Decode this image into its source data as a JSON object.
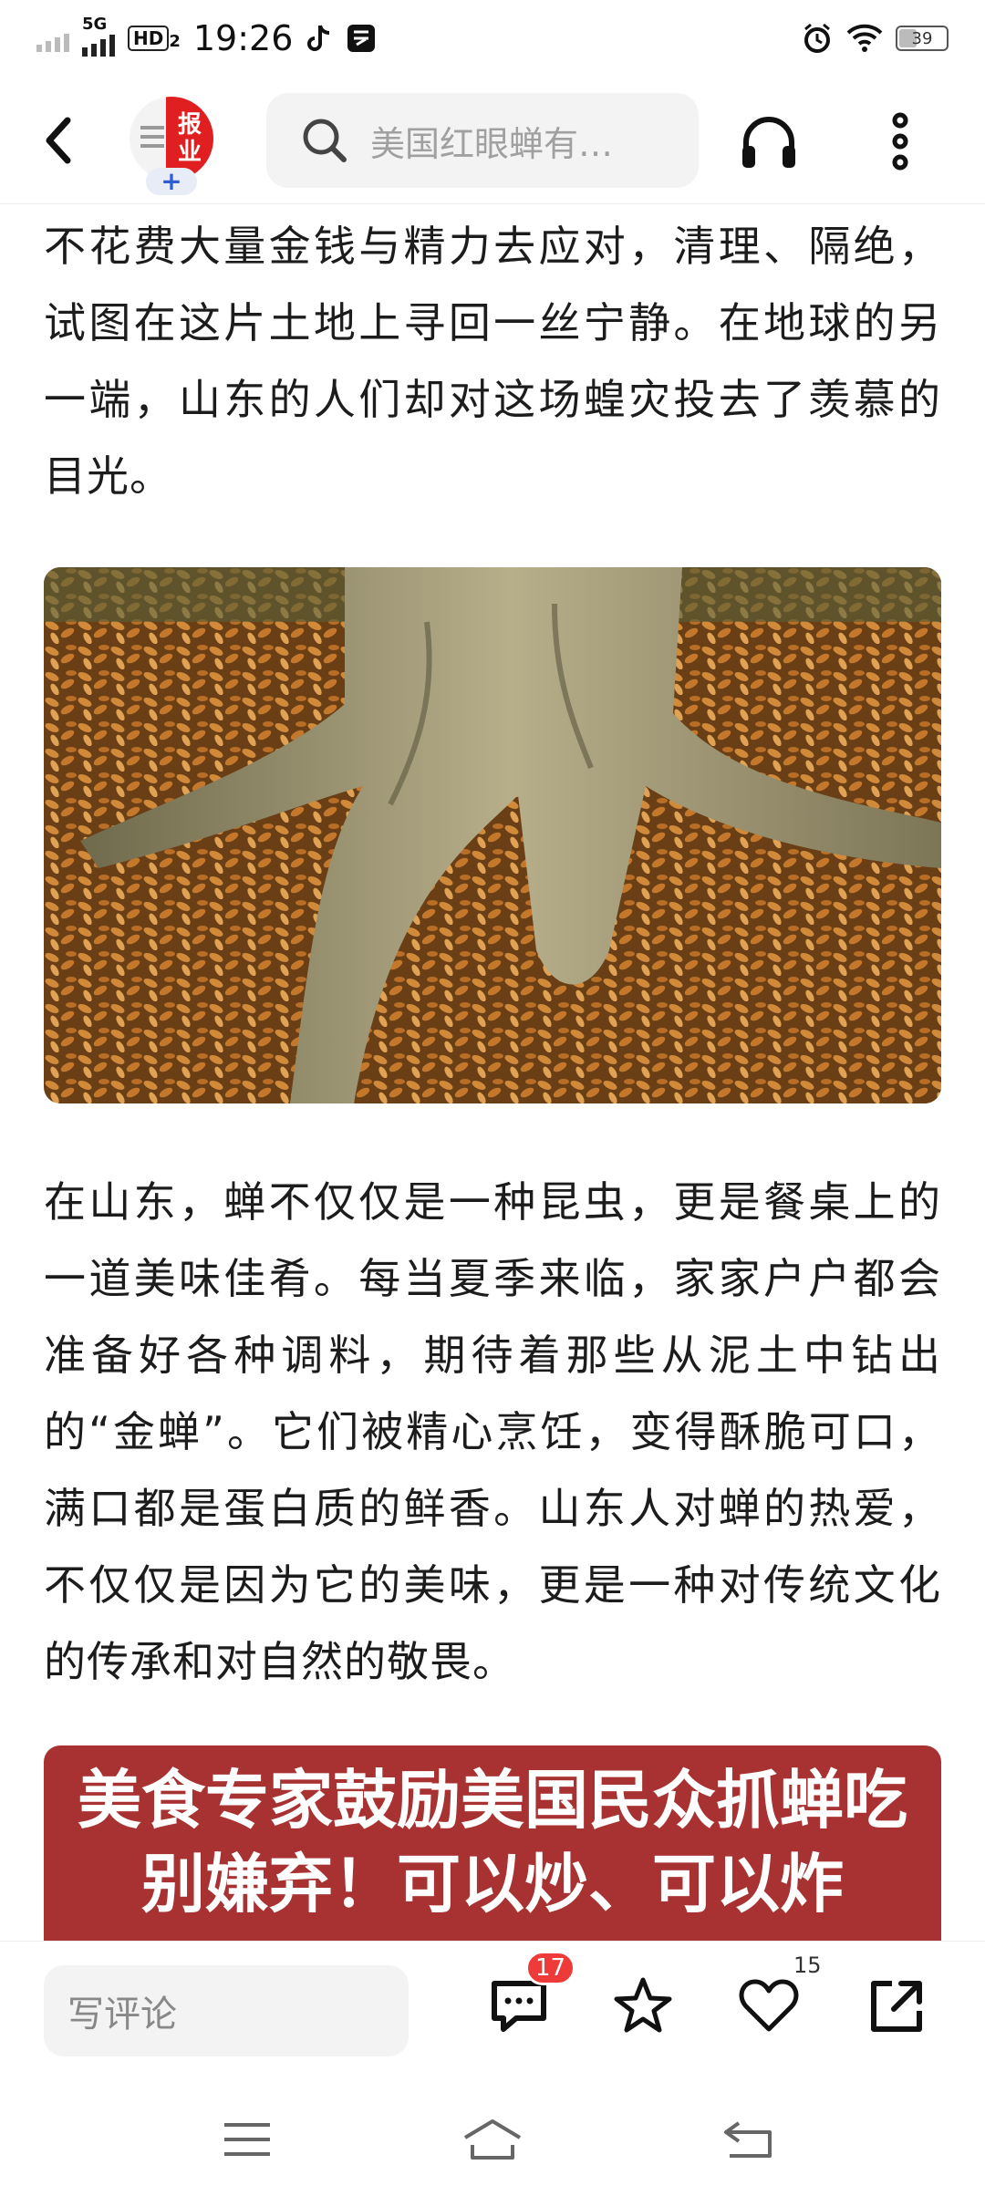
{
  "status_bar": {
    "network_label": "5G",
    "hd_label": "HD",
    "hd_sub": "2",
    "time": "19:26",
    "battery": "39"
  },
  "top_nav": {
    "logo_text_1": "报",
    "logo_text_2": "业",
    "logo_plus": "+",
    "search_placeholder": "美国红眼蝉有…"
  },
  "article": {
    "para_1": "不花费大量金钱与精力去应对，清理、隔绝，试图在这片土地上寻回一丝宁静。在地球的另一端，山东的人们却对这场蝗灾投去了羡慕的目光。",
    "para_2": "在山东，蝉不仅仅是一种昆虫，更是餐桌上的一道美味佳肴。每当夏季来临，家家户户都会准备好各种调料，期待着那些从泥土中钻出的“金蝉”。它们被精心烹饪，变得酥脆可口，满口都是蛋白质的鲜香。山东人对蝉的热爱，不仅仅是因为它的美味，更是一种对传统文化的传承和对自然的敬畏。",
    "banner_line_1": "美食专家鼓励美国民众抓蝉吃",
    "banner_line_2": "别嫌弃！可以炒、可以炸"
  },
  "bottom_bar": {
    "comment_placeholder": "写评论",
    "comment_count": "17",
    "like_count": "15"
  },
  "colors": {
    "accent_red": "#ef3a3a",
    "banner_red": "#a83232",
    "search_bg": "#f3f3f3"
  }
}
